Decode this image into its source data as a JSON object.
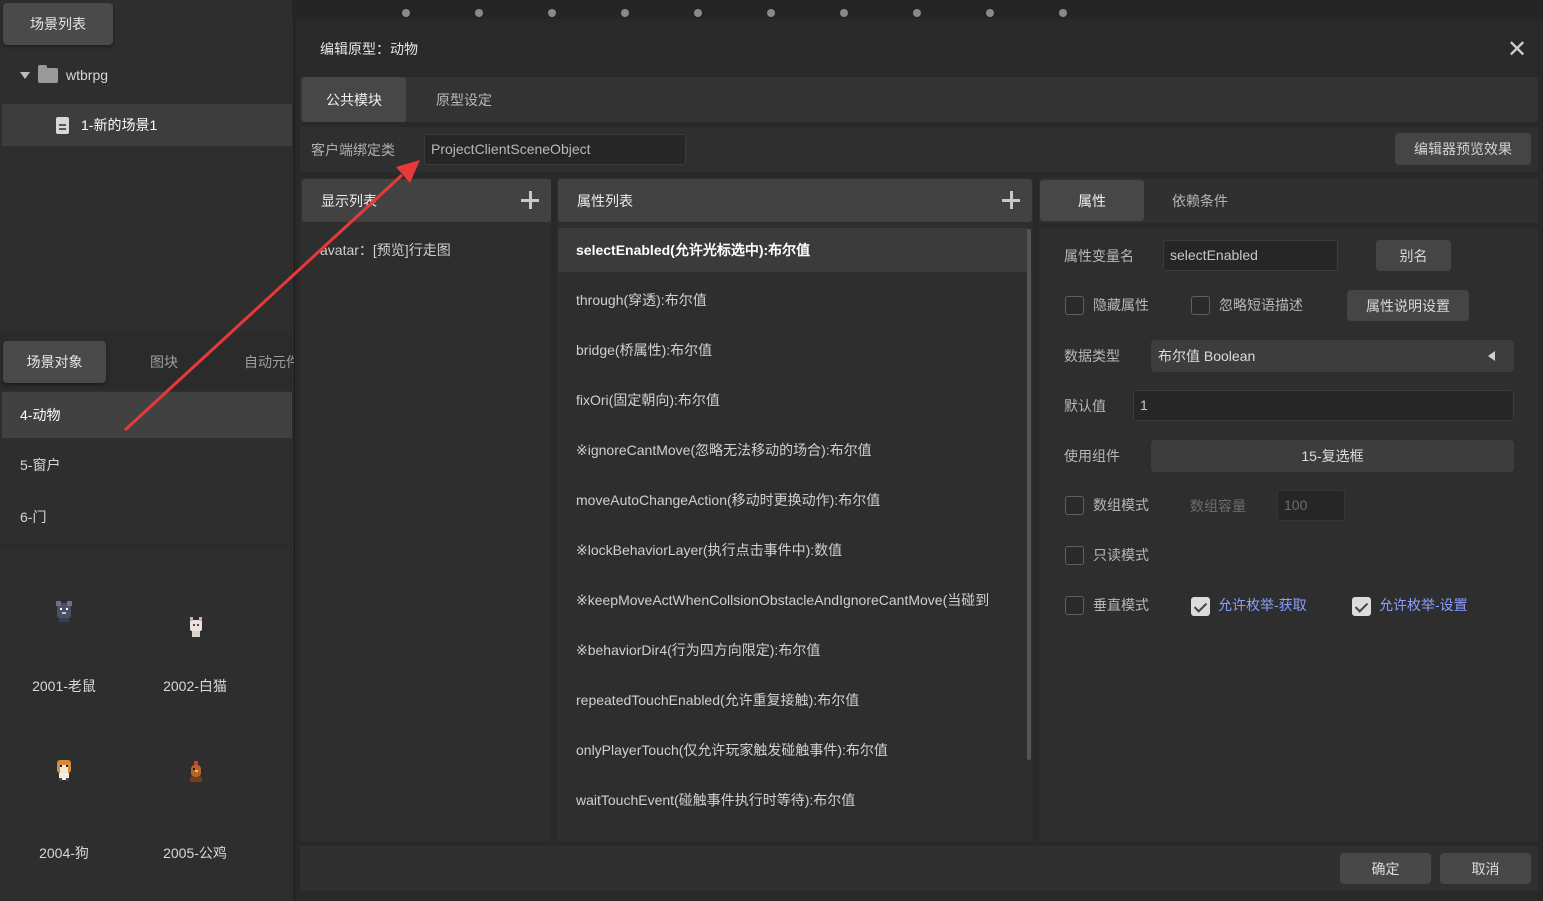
{
  "left": {
    "scene_list_label": "场景列表",
    "folder_name": "wtbrpg",
    "scene_name": "1-新的场景1",
    "tabs": [
      {
        "label": "场景对象"
      },
      {
        "label": "图块"
      },
      {
        "label": "自动元件"
      }
    ],
    "objects": [
      {
        "label": "4-动物"
      },
      {
        "label": "5-窗户"
      },
      {
        "label": "6-门"
      }
    ],
    "grid": [
      {
        "label": "2001-老鼠"
      },
      {
        "label": "2002-白猫"
      },
      {
        "label": "2004-狗"
      },
      {
        "label": "2005-公鸡"
      }
    ]
  },
  "dialog": {
    "title": "编辑原型：动物",
    "tabs": [
      {
        "label": "公共模块"
      },
      {
        "label": "原型设定"
      }
    ],
    "client_label": "客户端绑定类",
    "client_value": "ProjectClientSceneObject",
    "preview_button": "编辑器预览效果",
    "display_list": {
      "header": "显示列表",
      "items": [
        {
          "label": "avatar：[预览]行走图"
        }
      ]
    },
    "property_list": {
      "header": "属性列表",
      "items": [
        {
          "label": "selectEnabled(允许光标选中):布尔值"
        },
        {
          "label": "through(穿透):布尔值"
        },
        {
          "label": "bridge(桥属性):布尔值"
        },
        {
          "label": "fixOri(固定朝向):布尔值"
        },
        {
          "label": "※ignoreCantMove(忽略无法移动的场合):布尔值"
        },
        {
          "label": "moveAutoChangeAction(移动时更换动作):布尔值"
        },
        {
          "label": "※lockBehaviorLayer(执行点击事件中):数值"
        },
        {
          "label": "※keepMoveActWhenCollsionObstacleAndIgnoreCantMove(当碰到"
        },
        {
          "label": "※behaviorDir4(行为四方向限定):布尔值"
        },
        {
          "label": "repeatedTouchEnabled(允许重复接触):布尔值"
        },
        {
          "label": "onlyPlayerTouch(仅允许玩家触发碰触事件):布尔值"
        },
        {
          "label": "waitTouchEvent(碰触事件执行时等待):布尔值"
        }
      ]
    },
    "right_tabs": [
      {
        "label": "属性"
      },
      {
        "label": "依赖条件"
      }
    ],
    "attr": {
      "var_name_label": "属性变量名",
      "var_name_value": "selectEnabled",
      "alias_button": "别名",
      "hide_label": "隐藏属性",
      "ignore_desc_label": "忽略短语描述",
      "desc_settings_button": "属性说明设置",
      "datatype_label": "数据类型",
      "datatype_value": "布尔值 Boolean",
      "default_label": "默认值",
      "default_value": "1",
      "component_label": "使用组件",
      "component_value": "15-复选框",
      "array_mode_label": "数组模式",
      "array_capacity_label": "数组容量",
      "array_capacity_value": "100",
      "readonly_label": "只读模式",
      "vertical_label": "垂直模式",
      "enum_get_label": "允许枚举-获取",
      "enum_set_label": "允许枚举-设置"
    },
    "confirm_button": "确定",
    "cancel_button": "取消"
  },
  "colors": {
    "annotation_arrow": "#e8393a",
    "link_text": "#8a9eff"
  }
}
